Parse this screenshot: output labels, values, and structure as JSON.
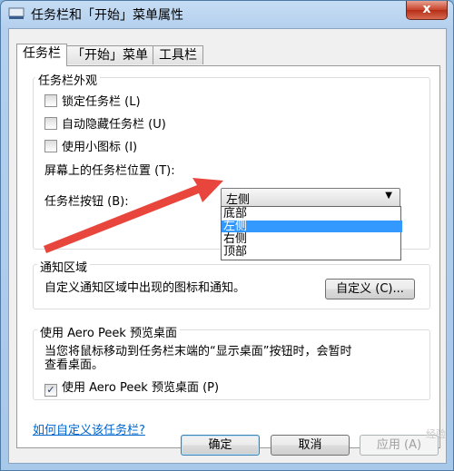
{
  "window": {
    "title": "任务栏和「开始」菜单属性",
    "close_label": "x"
  },
  "tabs": [
    {
      "label": "任务栏"
    },
    {
      "label": "「开始」菜单"
    },
    {
      "label": "工具栏"
    }
  ],
  "appearance": {
    "title": "任务栏外观",
    "lock_label": "锁定任务栏 (L)",
    "lock_checked": false,
    "autohide_label": "自动隐藏任务栏 (U)",
    "autohide_checked": false,
    "small_icons_label": "使用小图标 (I)",
    "small_icons_checked": false,
    "position_label": "屏幕上的任务栏位置 (T):",
    "position_value": "左侧",
    "position_options": [
      "底部",
      "左侧",
      "右侧",
      "顶部"
    ],
    "position_selected_index": 1,
    "buttons_label": "任务栏按钮 (B):"
  },
  "notification": {
    "title": "通知区域",
    "description": "自定义通知区域中出现的图标和通知。",
    "customize_button": "自定义 (C)..."
  },
  "aero_peek": {
    "title": "使用 Aero Peek 预览桌面",
    "description_line1": "当您将鼠标移动到任务栏末端的“显示桌面”按钮时，会暂时",
    "description_line2": "查看桌面。",
    "checkbox_label": "使用 Aero Peek 预览桌面 (P)",
    "checkbox_checked": true
  },
  "help_link": "如何自定义该任务栏?",
  "footer": {
    "ok": "确定",
    "cancel": "取消",
    "apply": "应用 (A)"
  },
  "watermark": "经验",
  "colors": {
    "selection": "#3399ff",
    "link": "#0066cc",
    "arrow": "#e8453c"
  }
}
